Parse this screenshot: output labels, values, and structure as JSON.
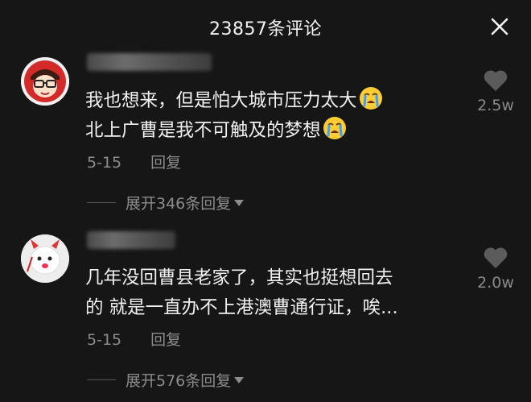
{
  "header": {
    "title": "23857条评论",
    "close_icon": "close-icon"
  },
  "comments": [
    {
      "text_line1": "我也想来，但是怕大城市压力太大",
      "text_line2": "北上广曹是我不可触及的梦想",
      "emoji": "crying-face-emoji",
      "date": "5-15",
      "reply_label": "回复",
      "likes": "2.5w",
      "expand_label": "展开346条回复"
    },
    {
      "text_line1": "几年没回曹县老家了，其实也挺想回去",
      "text_line2": "的 就是一直办不上港澳曹通行证，唉...",
      "date": "5-15",
      "reply_label": "回复",
      "likes": "2.0w",
      "expand_label": "展开576条回复"
    }
  ],
  "colors": {
    "background": "#161616",
    "text": "#f0f0f0",
    "muted": "#8c8c8c"
  }
}
